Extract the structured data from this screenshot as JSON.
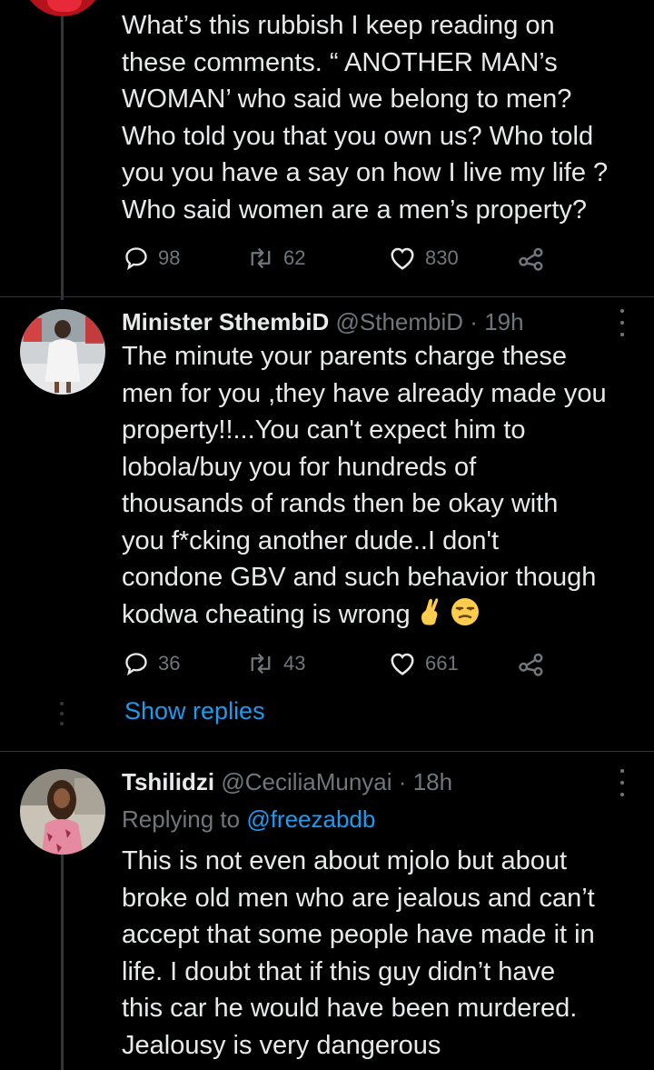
{
  "tweet1": {
    "text": "What’s this rubbish I keep reading on\nthese comments. “ ANOTHER MAN’s\nWOMAN’ who said we belong to men?\nWho told you that you own us? Who told\nyou you have a say on how I live my life ?\nWho said women are a men’s property?",
    "replies": "98",
    "retweets": "62",
    "likes": "830"
  },
  "tweet2": {
    "name": "Minister SthembiD",
    "handle": "@SthembiD",
    "sep": "·",
    "time": "19h",
    "text": "The minute your parents charge these\nmen for you ,they have already made you\nproperty!!...You can't expect him to\nlobola/buy you for hundreds of\nthousands of rands then be okay with\nyou f*cking another dude..I don't\ncondone GBV and such behavior though\nkodwa cheating is wrong",
    "replies": "36",
    "retweets": "43",
    "likes": "661",
    "show_replies": "Show replies"
  },
  "tweet3": {
    "name": "Tshilidzi",
    "handle": "@CeciliaMunyai",
    "sep": "·",
    "time": "18h",
    "replying_prefix": "Replying to",
    "replying_handle": "@freezabdb",
    "text": "This is not even about mjolo but about\nbroke old men who are jealous and can’t\naccept that some people have made it in\nlife. I doubt that if this guy didn’t have\nthis car he would have been murdered.\nJealousy is very dangerous"
  },
  "colors": {
    "background": "#000000",
    "text": "#e7e9ea",
    "muted": "#71767b",
    "link": "#1d9bf0",
    "divider": "#2f3336"
  },
  "icons": [
    "reply-icon",
    "retweet-icon",
    "like-icon",
    "share-icon",
    "more-icon"
  ]
}
